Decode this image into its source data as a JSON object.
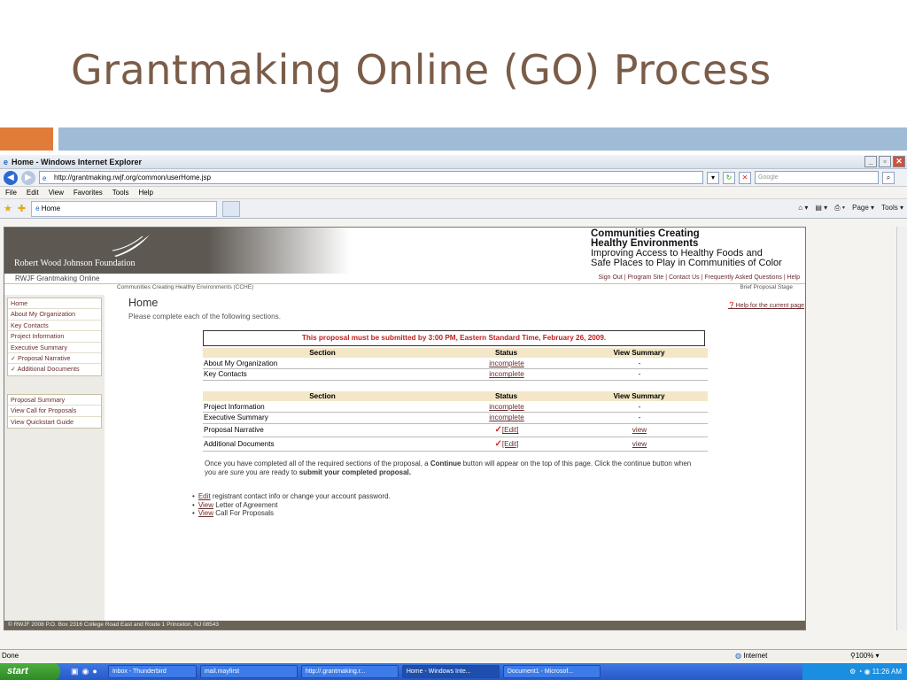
{
  "slide": {
    "title": "Grantmaking Online (GO) Process"
  },
  "browser": {
    "window_title": "Home - Windows Internet Explorer",
    "url": "http://grantmaking.rwjf.org/common/userHome.jsp",
    "search_placeholder": "Google",
    "menu": [
      "File",
      "Edit",
      "View",
      "Favorites",
      "Tools",
      "Help"
    ],
    "tab_label": "Home",
    "cmd_page": "Page",
    "cmd_tools": "Tools",
    "status_text": "Done",
    "zone": "Internet",
    "zoom": "100%"
  },
  "site": {
    "logo_text": "Robert Wood Johnson Foundation",
    "program_title_1": "Communities Creating",
    "program_title_2": "Healthy Environments",
    "program_sub_1": "Improving Access to Healthy Foods and",
    "program_sub_2": "Safe Places to Play in Communities of Color",
    "app_name": "RWJF Grantmaking Online",
    "top_links": "Sign Out | Program Site | Contact Us | Frequently Asked Questions | Help",
    "breadcrumb": "Communities Creating Healthy Environments (CCHE)",
    "stage": "Brief Proposal Stage",
    "footer": "© RWJF 2008   P.O. Box 2316 College Road East and Route 1 Princeton, NJ 08543"
  },
  "sidebar": {
    "items": [
      "Home",
      "About My Organization",
      "Key Contacts",
      "Project Information",
      "Executive Summary",
      "✓ Proposal Narrative",
      "✓ Additional Documents"
    ],
    "items2": [
      "Proposal Summary",
      "View Call for Proposals",
      "View Quickstart Guide"
    ]
  },
  "main": {
    "heading": "Home",
    "help": "Help for the current page",
    "intro": "Please complete each of the following sections.",
    "alert": "This proposal must be submitted by 3:00 PM, Eastern Standard Time, February 26, 2009.",
    "col_section": "Section",
    "col_status": "Status",
    "col_summary": "View Summary",
    "table1": [
      {
        "section": "About My Organization",
        "status": "incomplete",
        "summary": "-"
      },
      {
        "section": "Key Contacts",
        "status": "incomplete",
        "summary": "-"
      }
    ],
    "table2": [
      {
        "section": "Project Information",
        "status": "incomplete",
        "summary": "-"
      },
      {
        "section": "Executive Summary",
        "status": "incomplete",
        "summary": "-"
      },
      {
        "section": "Proposal Narrative",
        "status": "[Edit]",
        "summary": "view"
      },
      {
        "section": "Additional Documents",
        "status": "[Edit]",
        "summary": "view"
      }
    ],
    "note_a": "Once you have completed all of the required sections of the proposal, a ",
    "note_b": "Continue",
    "note_c": " button will appear on the top of this page. Click the continue button when you are ",
    "note_d": "sure",
    "note_e": " you are ready to ",
    "note_f": "submit your completed proposal.",
    "b1_link": "Edit",
    "b1_text": " registrant contact info or change your account password.",
    "b2_link": "View",
    "b2_text": " Letter of Agreement",
    "b3_link": "View",
    "b3_text": " Call For Proposals"
  },
  "taskbar": {
    "start": "start",
    "tasks": [
      "Inbox - Thunderbird",
      "mail.mayfirst",
      "http://.grantmaking.r...",
      "Home - Windows Inte...",
      "Document1 - Microsof..."
    ],
    "clock": "11:26 AM"
  }
}
